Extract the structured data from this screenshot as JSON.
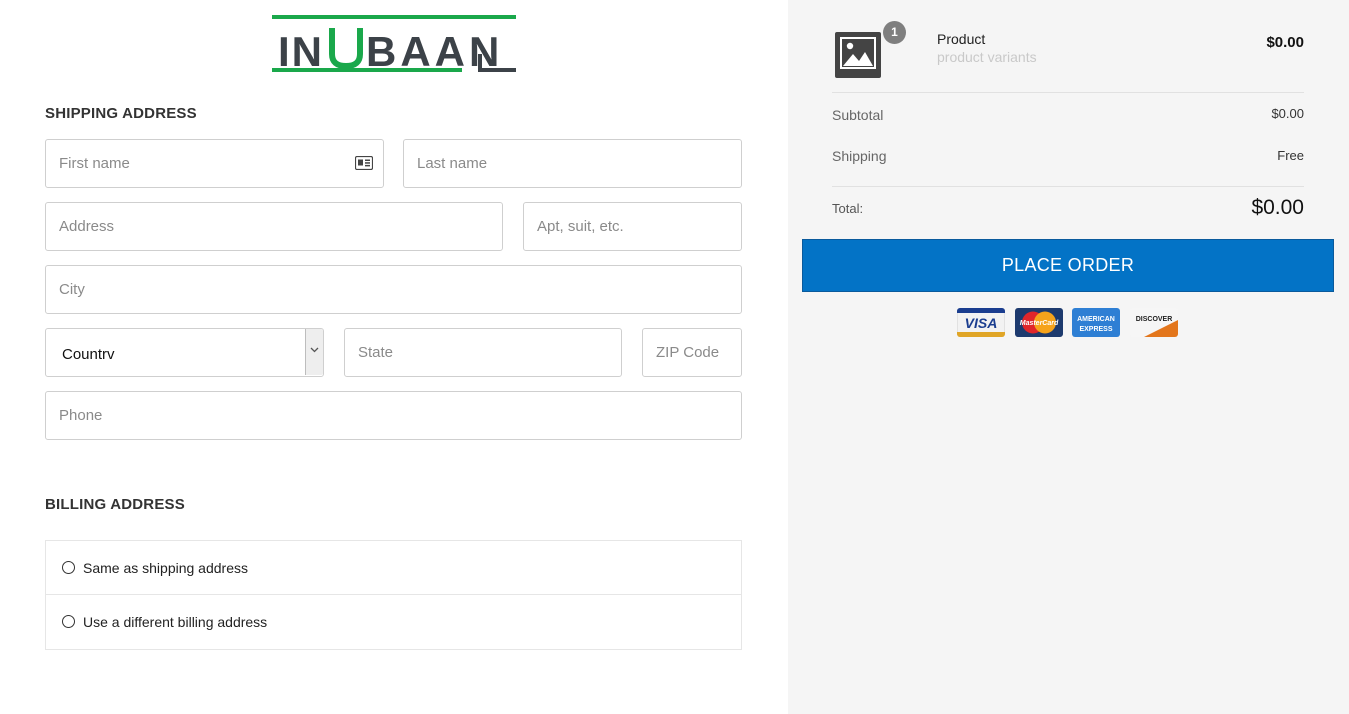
{
  "brand": {
    "name": "INUBAAN",
    "accent": "#1aa84b",
    "dark": "#3c4248"
  },
  "shipping": {
    "title": "SHIPPING ADDRESS",
    "first_name_placeholder": "First name",
    "last_name_placeholder": "Last name",
    "address_placeholder": "Address",
    "apt_placeholder": "Apt, suit, etc.",
    "city_placeholder": "City",
    "country_value": "Countrv",
    "state_placeholder": "State",
    "zip_placeholder": "ZIP Code",
    "phone_placeholder": "Phone"
  },
  "billing": {
    "title": "BILLING ADDRESS",
    "options": [
      {
        "label": "Same as shipping address"
      },
      {
        "label": "Use a different billing address"
      }
    ]
  },
  "summary": {
    "product": {
      "name": "Product",
      "variants": "product variants",
      "price": "$0.00",
      "quantity": "1",
      "icon": "image-placeholder-icon"
    },
    "subtotal_label": "Subtotal",
    "subtotal_value": "$0.00",
    "shipping_label": "Shipping",
    "shipping_value": "Free",
    "total_label": "Total:",
    "total_value": "$0.00",
    "place_order": "PLACE ORDER",
    "button_color": "#0373c6"
  },
  "payment_cards": [
    {
      "name": "VISA",
      "icon": "visa-icon"
    },
    {
      "name": "MasterCard",
      "icon": "mastercard-icon"
    },
    {
      "name": "AMERICAN EXPRESS",
      "icon": "amex-icon"
    },
    {
      "name": "DISCOVER",
      "icon": "discover-icon"
    }
  ]
}
